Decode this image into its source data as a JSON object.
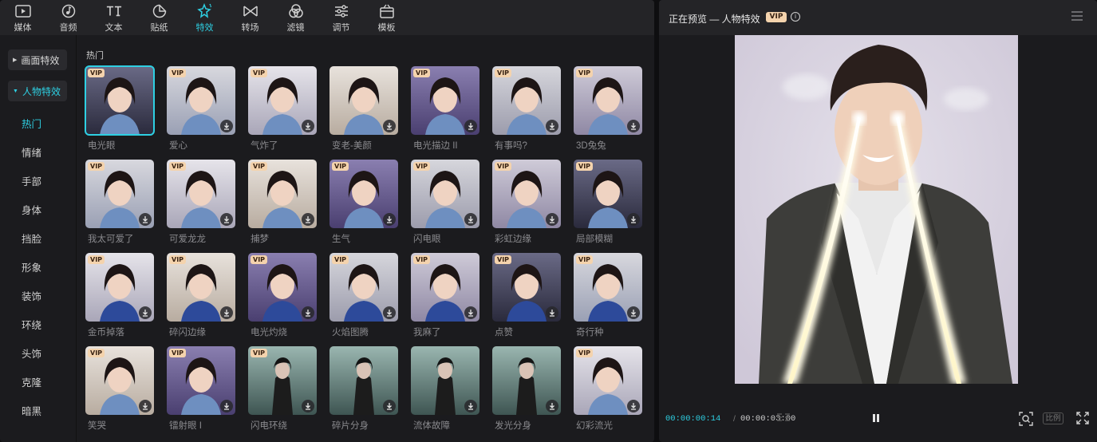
{
  "toolbar": {
    "items": [
      {
        "label": "媒体",
        "icon": "media-icon"
      },
      {
        "label": "音频",
        "icon": "audio-icon"
      },
      {
        "label": "文本",
        "icon": "text-icon"
      },
      {
        "label": "贴纸",
        "icon": "sticker-icon"
      },
      {
        "label": "特效",
        "icon": "effects-icon",
        "active": true
      },
      {
        "label": "转场",
        "icon": "transition-icon"
      },
      {
        "label": "滤镜",
        "icon": "filter-icon"
      },
      {
        "label": "调节",
        "icon": "adjust-icon"
      },
      {
        "label": "模板",
        "icon": "template-icon"
      }
    ],
    "accent_color": "#2ed0e3"
  },
  "sidebar": {
    "categories": [
      {
        "label": "画面特效",
        "expanded": false
      },
      {
        "label": "人物特效",
        "expanded": true
      }
    ],
    "subitems": [
      "热门",
      "情绪",
      "手部",
      "身体",
      "挡脸",
      "形象",
      "装饰",
      "环绕",
      "头饰",
      "克隆",
      "暗黑"
    ],
    "active_subitem": "热门"
  },
  "content": {
    "section_title": "热门",
    "vip_label": "VIP",
    "effects": [
      {
        "name": "电光眼",
        "vip": true,
        "selected": true
      },
      {
        "name": "爱心",
        "vip": true
      },
      {
        "name": "气炸了",
        "vip": true
      },
      {
        "name": "变老-美颜",
        "vip": false
      },
      {
        "name": "电光描边 II",
        "vip": true
      },
      {
        "name": "有事吗?",
        "vip": true
      },
      {
        "name": "3D兔兔",
        "vip": true
      },
      {
        "name": "我太可爱了",
        "vip": true
      },
      {
        "name": "可爱龙龙",
        "vip": true
      },
      {
        "name": "捕梦",
        "vip": true
      },
      {
        "name": "生气",
        "vip": true
      },
      {
        "name": "闪电眼",
        "vip": true
      },
      {
        "name": "彩虹边缘",
        "vip": true
      },
      {
        "name": "局部模糊",
        "vip": true
      },
      {
        "name": "金币掉落",
        "vip": true
      },
      {
        "name": "碎闪边缘",
        "vip": true
      },
      {
        "name": "电光灼烧",
        "vip": true
      },
      {
        "name": "火焰图腾",
        "vip": true
      },
      {
        "name": "我麻了",
        "vip": true
      },
      {
        "name": "点赞",
        "vip": true
      },
      {
        "name": "奇行种",
        "vip": true
      },
      {
        "name": "笑哭",
        "vip": true
      },
      {
        "name": "镭射眼 I",
        "vip": true
      },
      {
        "name": "闪电环绕",
        "vip": true
      },
      {
        "name": "碎片分身",
        "vip": false
      },
      {
        "name": "流体故障",
        "vip": false
      },
      {
        "name": "发光分身",
        "vip": false
      },
      {
        "name": "幻彩流光",
        "vip": true
      }
    ]
  },
  "preview": {
    "title": "正在预览 — 人物特效",
    "vip_label": "VIP",
    "current_time": "00:00:00:14",
    "separator": "/",
    "total_time": "00:00:03:00",
    "ratio_label": "比例"
  }
}
